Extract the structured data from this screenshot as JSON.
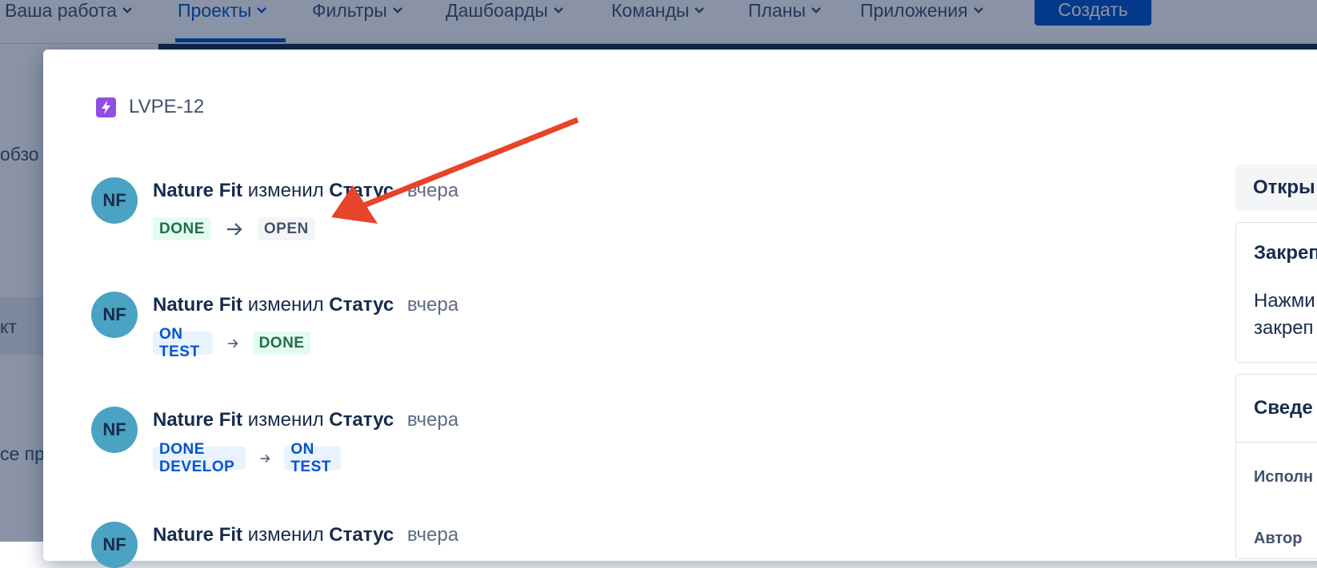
{
  "topnav": {
    "items": [
      {
        "label": "Ваша работа"
      },
      {
        "label": "Проекты"
      },
      {
        "label": "Фильтры"
      },
      {
        "label": "Дашбоарды"
      },
      {
        "label": "Команды"
      },
      {
        "label": "Планы"
      },
      {
        "label": "Приложения"
      }
    ],
    "create_label": "Создать"
  },
  "sidebar": {
    "fragments": [
      "обзо",
      "кт",
      "се пр"
    ]
  },
  "issue": {
    "key": "LVPE-12",
    "type_icon": "lightning-icon",
    "type_color": "#904ee2"
  },
  "history": [
    {
      "initials": "NF",
      "author": "Nature Fit",
      "action": "изменил",
      "field": "Статус",
      "when": "вчера",
      "from": "DONE",
      "to": "OPEN"
    },
    {
      "initials": "NF",
      "author": "Nature Fit",
      "action": "изменил",
      "field": "Статус",
      "when": "вчера",
      "from": "ON TEST",
      "to": "DONE"
    },
    {
      "initials": "NF",
      "author": "Nature Fit",
      "action": "изменил",
      "field": "Статус",
      "when": "вчера",
      "from": "DONE DEVELOP",
      "to": "ON TEST"
    },
    {
      "initials": "NF",
      "author": "Nature Fit",
      "action": "изменил",
      "field": "Статус",
      "when": "вчера"
    }
  ],
  "right_panel": {
    "status_button": "Откры",
    "pinned": {
      "title": "Закреп",
      "line1": "Нажми",
      "line2": "закреп"
    },
    "details": {
      "title": "Сведе",
      "assignee_label": "Исполн",
      "reporter_label": "Автор"
    }
  },
  "colors": {
    "accent": "#0052cc",
    "annotation_arrow": "#e8432b",
    "avatar": "#4ba3c3"
  }
}
